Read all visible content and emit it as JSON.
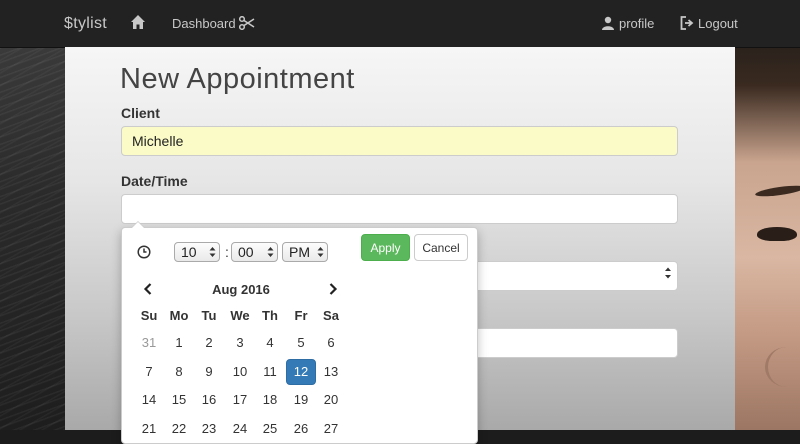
{
  "navbar": {
    "brand": "$tylist",
    "dashboard_label": "Dashboard",
    "profile_label": "profile",
    "logout_label": "Logout"
  },
  "page": {
    "title": "New Appointment"
  },
  "form": {
    "client_label": "Client",
    "client_value": "Michelle",
    "datetime_label": "Date/Time",
    "datetime_value": ""
  },
  "picker": {
    "hour": "10",
    "minute": "00",
    "ampm": "PM",
    "apply_label": "Apply",
    "cancel_label": "Cancel",
    "month_label": "Aug 2016",
    "weekdays": [
      "Su",
      "Mo",
      "Tu",
      "We",
      "Th",
      "Fr",
      "Sa"
    ],
    "weeks": [
      [
        "31",
        "1",
        "2",
        "3",
        "4",
        "5",
        "6"
      ],
      [
        "7",
        "8",
        "9",
        "10",
        "11",
        "12",
        "13"
      ],
      [
        "14",
        "15",
        "16",
        "17",
        "18",
        "19",
        "20"
      ],
      [
        "21",
        "22",
        "23",
        "24",
        "25",
        "26",
        "27"
      ]
    ],
    "selected_day": "12",
    "accent_color": "#337ab7",
    "apply_color": "#5cb85c"
  },
  "icons": {
    "home": "home-icon",
    "scissors": "scissors-icon",
    "user": "user-icon",
    "logout": "logout-icon",
    "clock": "clock-icon",
    "prev": "chevron-left-icon",
    "next": "chevron-right-icon"
  }
}
